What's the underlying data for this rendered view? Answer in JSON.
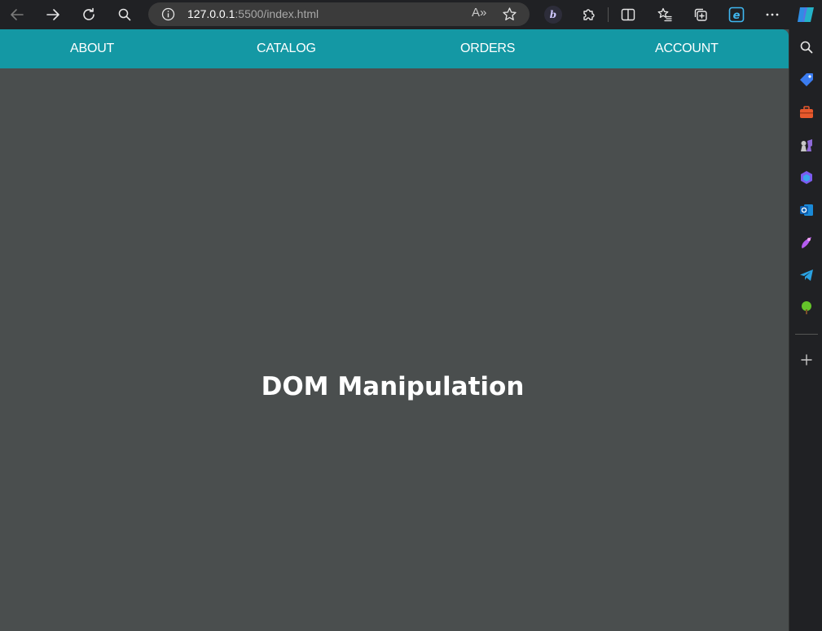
{
  "browser": {
    "url_host": "127.0.0.1",
    "url_path": ":5500/index.html",
    "read_aloud_label": "A»"
  },
  "nav": {
    "items": [
      {
        "label": "ABOUT"
      },
      {
        "label": "CATALOG"
      },
      {
        "label": "ORDERS"
      },
      {
        "label": "ACCOUNT"
      }
    ]
  },
  "main": {
    "heading": "DOM Manipulation"
  },
  "colors": {
    "navbar": "#1498a4",
    "page_background": "#4a4e4e",
    "browser_chrome": "#202124"
  },
  "sidebar": {
    "icons": [
      "search-icon",
      "shopping-tag-icon",
      "toolbox-icon",
      "chess-icon",
      "copilot-icon",
      "outlook-icon",
      "designer-icon",
      "telegram-icon",
      "tree-icon",
      "add-icon"
    ]
  }
}
